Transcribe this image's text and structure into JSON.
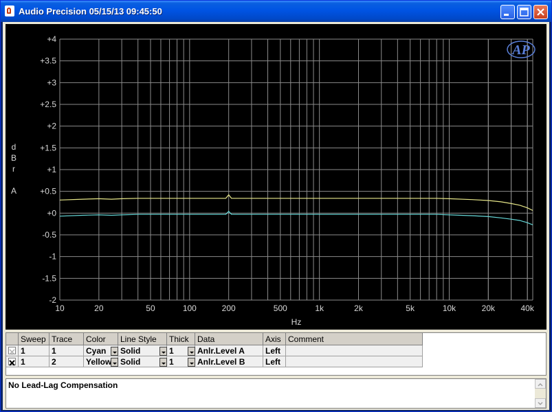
{
  "window": {
    "title": "Audio Precision  05/15/13 09:45:50",
    "buttons": {
      "minimize": "minimize-icon",
      "maximize": "maximize-icon",
      "close": "close-icon"
    }
  },
  "plot": {
    "background": "#000000",
    "logo": "AP",
    "grid_color": "#8c8c8c",
    "chart_data": {
      "type": "line",
      "xlabel": "Hz",
      "ylabel": "dBr A",
      "x_scale": "log",
      "xlim": [
        10,
        44000
      ],
      "ylim": [
        -2,
        4
      ],
      "grid": true,
      "y_ticks": [
        {
          "value": 4,
          "label": "+4"
        },
        {
          "value": 3.5,
          "label": "+3.5"
        },
        {
          "value": 3,
          "label": "+3"
        },
        {
          "value": 2.5,
          "label": "+2.5"
        },
        {
          "value": 2,
          "label": "+2"
        },
        {
          "value": 1.5,
          "label": "+1.5"
        },
        {
          "value": 1,
          "label": "+1"
        },
        {
          "value": 0.5,
          "label": "+0.5"
        },
        {
          "value": 0,
          "label": "+0"
        },
        {
          "value": -0.5,
          "label": "-0.5"
        },
        {
          "value": -1,
          "label": "-1"
        },
        {
          "value": -1.5,
          "label": "-1.5"
        },
        {
          "value": -2,
          "label": "-2"
        }
      ],
      "x_ticks": [
        {
          "value": 10,
          "label": "10"
        },
        {
          "value": 20,
          "label": "20"
        },
        {
          "value": 50,
          "label": "50"
        },
        {
          "value": 100,
          "label": "100"
        },
        {
          "value": 200,
          "label": "200"
        },
        {
          "value": 500,
          "label": "500"
        },
        {
          "value": 1000,
          "label": "1k"
        },
        {
          "value": 2000,
          "label": "2k"
        },
        {
          "value": 5000,
          "label": "5k"
        },
        {
          "value": 10000,
          "label": "10k"
        },
        {
          "value": 20000,
          "label": "20k"
        },
        {
          "value": 40000,
          "label": "40k"
        }
      ],
      "series": [
        {
          "color": "#66d9d9",
          "x": [
            10,
            15,
            20,
            25,
            30,
            40,
            60,
            100,
            150,
            190,
            200,
            210,
            300,
            500,
            1000,
            2000,
            3000,
            5000,
            8000,
            10000,
            15000,
            20000,
            25000,
            30000,
            35000,
            40000,
            44000
          ],
          "y": [
            -0.07,
            -0.05,
            -0.04,
            -0.05,
            -0.04,
            -0.03,
            -0.03,
            -0.03,
            -0.03,
            -0.03,
            0.04,
            -0.03,
            -0.03,
            -0.03,
            -0.03,
            -0.03,
            -0.03,
            -0.03,
            -0.03,
            -0.04,
            -0.06,
            -0.08,
            -0.11,
            -0.14,
            -0.17,
            -0.22,
            -0.27
          ]
        },
        {
          "color": "#e8e88a",
          "x": [
            10,
            15,
            20,
            25,
            30,
            40,
            60,
            100,
            150,
            190,
            200,
            210,
            300,
            500,
            1000,
            2000,
            3000,
            5000,
            8000,
            10000,
            15000,
            20000,
            25000,
            30000,
            35000,
            40000,
            44000
          ],
          "y": [
            0.3,
            0.32,
            0.33,
            0.32,
            0.33,
            0.34,
            0.34,
            0.34,
            0.34,
            0.34,
            0.42,
            0.34,
            0.34,
            0.34,
            0.34,
            0.34,
            0.34,
            0.34,
            0.34,
            0.33,
            0.31,
            0.29,
            0.26,
            0.22,
            0.18,
            0.12,
            0.06
          ]
        }
      ]
    }
  },
  "table": {
    "headers": [
      "Sweep",
      "Trace",
      "Color",
      "Line Style",
      "Thick",
      "Data",
      "Axis",
      "Comment"
    ],
    "rows": [
      {
        "checked": false,
        "sweep": "1",
        "trace": "1",
        "color": "Cyan",
        "line_style": "Solid",
        "thick": "1",
        "data": "Anlr.Level A",
        "axis": "Left",
        "comment": ""
      },
      {
        "checked": true,
        "sweep": "1",
        "trace": "2",
        "color": "Yellow",
        "line_style": "Solid",
        "thick": "1",
        "data": "Anlr.Level B",
        "axis": "Left",
        "comment": ""
      }
    ]
  },
  "comment_box": {
    "text": "No Lead-Lag Compensation"
  }
}
